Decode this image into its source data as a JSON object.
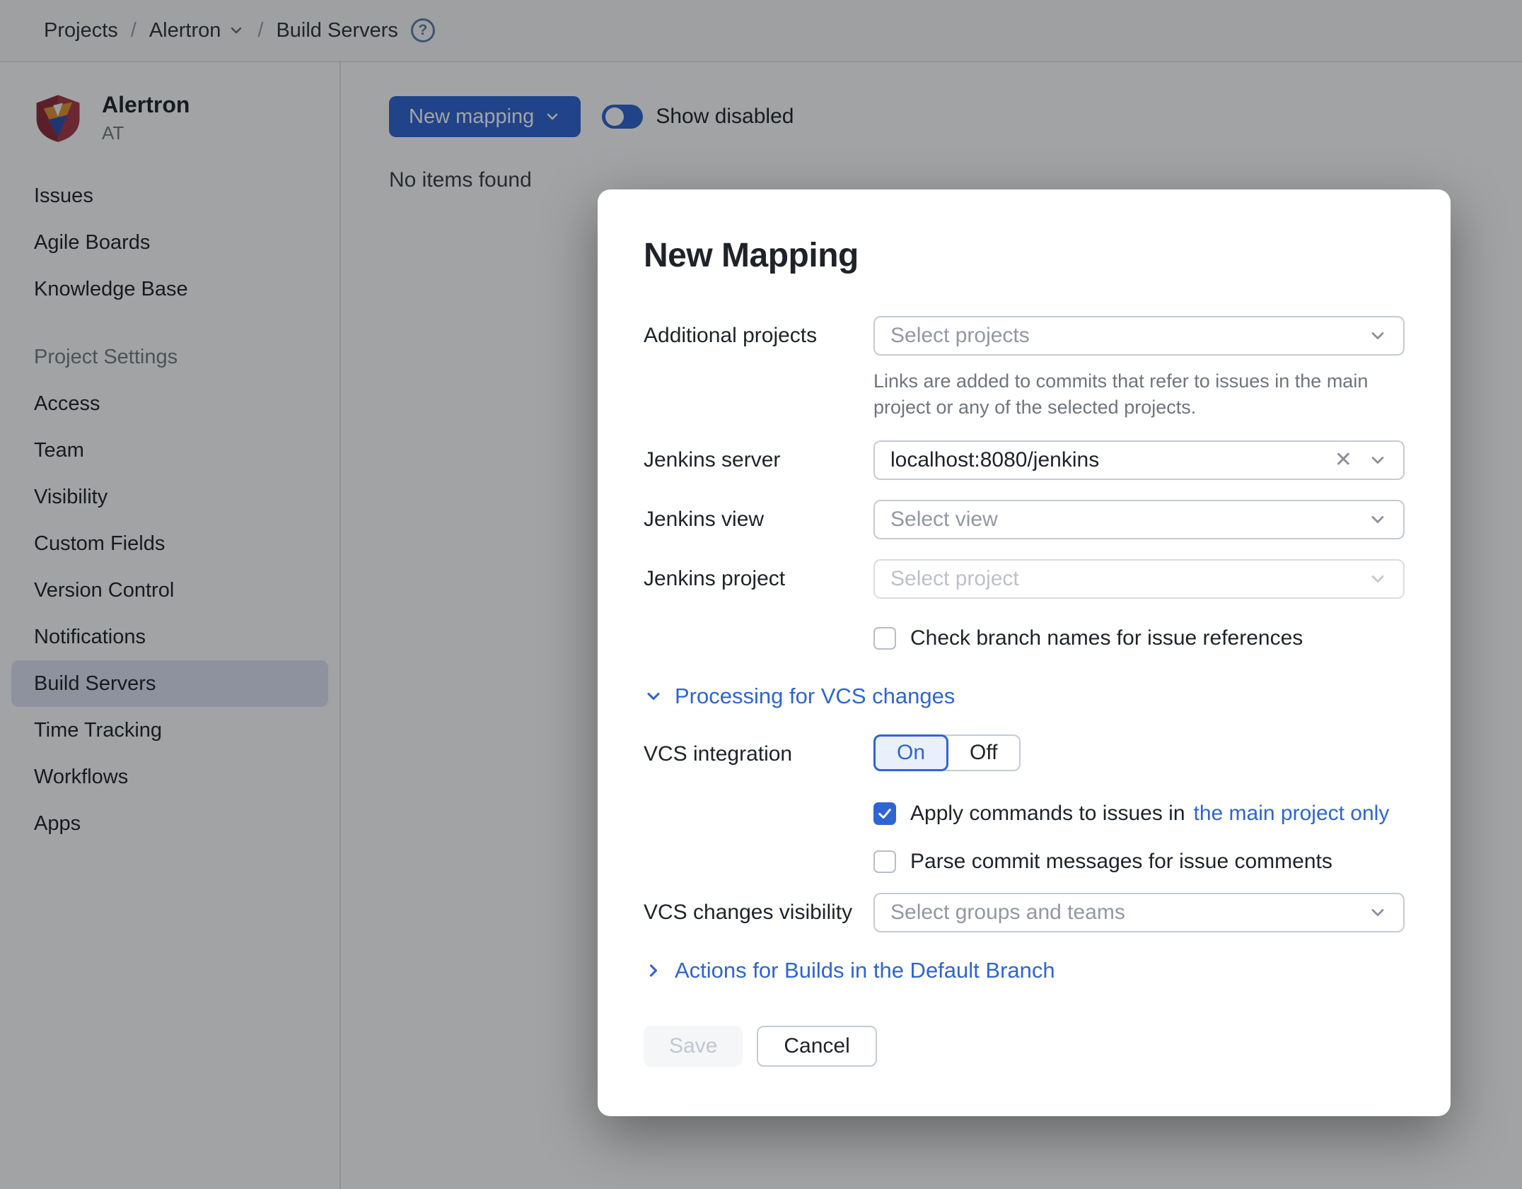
{
  "colors": {
    "accent": "#2e65d3",
    "selected_nav_bg": "#dde4f5"
  },
  "breadcrumb": {
    "items": [
      "Projects",
      "Alertron",
      "Build Servers"
    ],
    "separator": "/"
  },
  "sidebar": {
    "project_name": "Alertron",
    "project_key": "AT",
    "nav_items": [
      "Issues",
      "Agile Boards",
      "Knowledge Base"
    ],
    "section_header": "Project Settings",
    "settings_items": [
      "Access",
      "Team",
      "Visibility",
      "Custom Fields",
      "Version Control",
      "Notifications",
      "Build Servers",
      "Time Tracking",
      "Workflows",
      "Apps"
    ],
    "selected_item": "Build Servers"
  },
  "main": {
    "new_mapping_button": "New mapping",
    "show_disabled_label": "Show disabled",
    "show_disabled_on": true,
    "empty_text": "No items found"
  },
  "modal": {
    "title": "New Mapping",
    "fields": {
      "additional_projects": {
        "label": "Additional projects",
        "placeholder": "Select projects",
        "help": "Links are added to commits that refer to issues in the main project or any of the selected projects."
      },
      "jenkins_server": {
        "label": "Jenkins server",
        "value": "localhost:8080/jenkins",
        "clear": "×"
      },
      "jenkins_view": {
        "label": "Jenkins view",
        "placeholder": "Select view"
      },
      "jenkins_project": {
        "label": "Jenkins project",
        "placeholder": "Select project",
        "disabled": true
      },
      "check_branch": {
        "label": "Check branch names for issue references",
        "checked": false
      },
      "vcs_integration": {
        "label": "VCS integration",
        "on_label": "On",
        "off_label": "Off",
        "value": "On"
      },
      "apply_commands": {
        "label": "Apply commands to issues in",
        "link": "the main project only",
        "checked": true
      },
      "parse_commits": {
        "label": "Parse commit messages for issue comments",
        "checked": false
      },
      "vcs_visibility": {
        "label": "VCS changes visibility",
        "placeholder": "Select groups and teams"
      }
    },
    "sections": {
      "processing": "Processing for VCS changes",
      "actions": "Actions for Builds in the Default Branch"
    },
    "buttons": {
      "save": "Save",
      "cancel": "Cancel"
    }
  }
}
